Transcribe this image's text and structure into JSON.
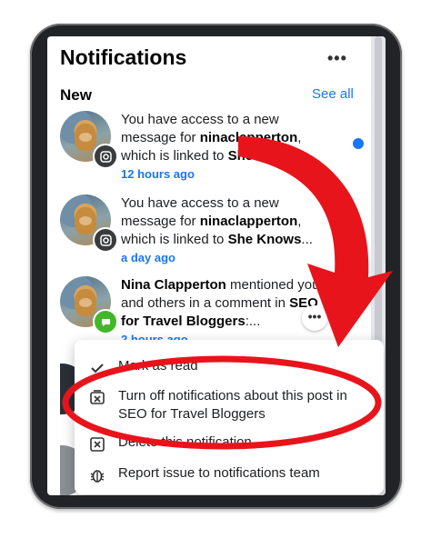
{
  "header": {
    "title": "Notifications",
    "more_label": "•••"
  },
  "section": {
    "label": "New",
    "see_all": "See all"
  },
  "notifications": [
    {
      "pre": "You have access to a new message for ",
      "user": "ninaclapperton",
      "mid": ", which is linked to ",
      "page": "She Knows",
      "post": ":..",
      "time": "12 hours ago",
      "badge_icon": "instagram-icon",
      "unread": true
    },
    {
      "pre": "You have access to a new message for ",
      "user": "ninaclapperton",
      "mid": ", which is linked to ",
      "page": "She Knows",
      "post": "...",
      "time": "a day ago",
      "badge_icon": "instagram-icon",
      "unread": true
    },
    {
      "name": "Nina Clapperton",
      "text": " mentioned you and others in a comment in ",
      "group": "SEO for Travel Bloggers",
      "post": ":...",
      "time": "2 hours ago",
      "badge_icon": "messenger-icon"
    }
  ],
  "options_button": "•••",
  "menu": {
    "items": [
      {
        "icon": "checkmark-icon",
        "label": "Mark as read"
      },
      {
        "icon": "notification-off-icon",
        "label": "Turn off notifications about this post in SEO for Travel Bloggers"
      },
      {
        "icon": "delete-notification-icon",
        "label": "Delete this notification"
      },
      {
        "icon": "bug-icon",
        "label": "Report issue to notifications team"
      }
    ]
  },
  "colors": {
    "accent": "#1877f2",
    "annotation": "#e8141c"
  }
}
